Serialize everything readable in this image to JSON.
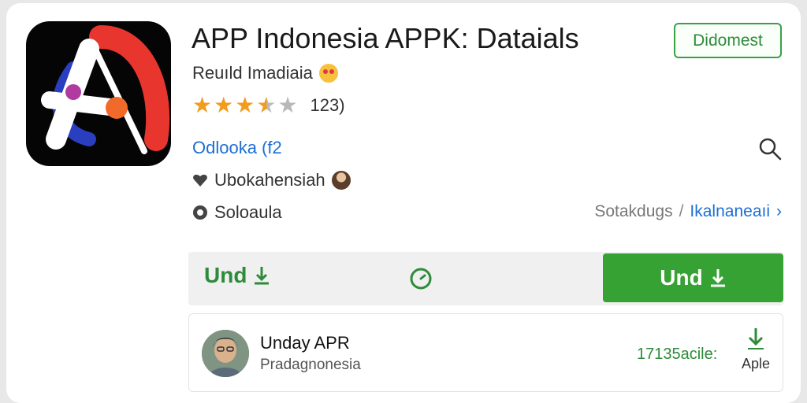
{
  "app": {
    "title": "APP Indonesia APPK: Dataials",
    "developer": "Reuıld Imadiaia",
    "rating_count": "123)",
    "rating": 3.5,
    "rating_max": 5,
    "link": "Odlooka (f2",
    "meta_1": "Ubokahensiah",
    "meta_2": "Soloaula",
    "icon": "app-logo-a-icon",
    "colors": {
      "accent_green": "#36a233",
      "link_blue": "#1d6fd1",
      "star": "#f39b1c"
    }
  },
  "top_badge": {
    "label": "Didomest"
  },
  "breadcrumb": {
    "first": "Sotakdugs",
    "separator": "/",
    "second": "Ikalnaneaıi",
    "chevron": "›"
  },
  "actions": {
    "left_label": "Und",
    "install_label": "Und",
    "left_icon": "download-arrow-icon",
    "timer_icon": "clock-icon"
  },
  "review": {
    "name": "Unday APR",
    "subtitle": "Pradagnonesia",
    "count": "17135acile:",
    "download_label": "Aple"
  }
}
